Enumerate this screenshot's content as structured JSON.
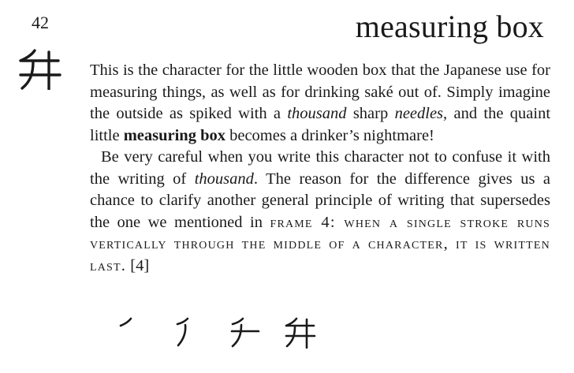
{
  "header": {
    "frame_number": "42",
    "keyword": "measuring box",
    "kanji_icon": "kanji-masu-icon"
  },
  "paragraph1": {
    "t1": "This is the character for the little wooden box that the Japan­ese use for measuring things, as well as for drinking saké out of. Simply imagine the outside as spiked with a ",
    "em1": "thousand",
    "t2": " sharp ",
    "em2": "needles",
    "t3": ", and the quaint little ",
    "bold": "measuring box",
    "t4": " becomes a drinker’s nightmare!"
  },
  "paragraph2": {
    "t1": "Be very careful when you write this character not to confuse it with the writing of ",
    "em1": "thousand",
    "t2": ". The reason for the difference gives us a chance to clarify another general principle of writing that supersedes the one we mentioned in ",
    "sc": "frame 4: when a single stroke runs vertically through the middle of a character, it is written last.",
    "t3": " [4]"
  },
  "stroke_order": {
    "icons": [
      "stroke-1-icon",
      "stroke-2-icon",
      "stroke-3-icon",
      "stroke-4-icon"
    ]
  }
}
